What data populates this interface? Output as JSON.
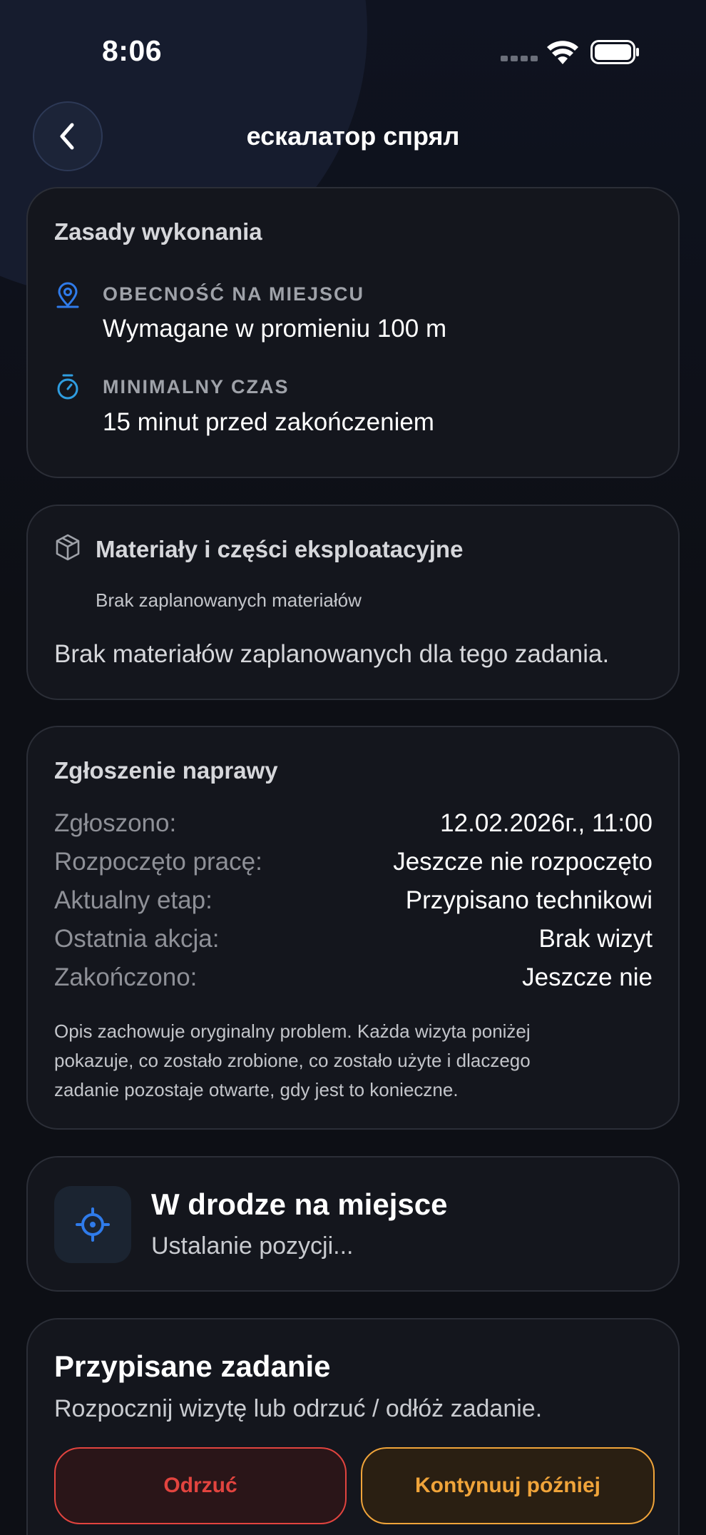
{
  "status_bar": {
    "time": "8:06"
  },
  "nav": {
    "title": "ескалатор спрял"
  },
  "rules_card": {
    "title": "Zasady wykonania",
    "presence_label": "OBECNOŚĆ NA MIEJSCU",
    "presence_value": "Wymagane w promieniu 100 m",
    "min_time_label": "MINIMALNY CZAS",
    "min_time_value": "15 minut przed zakończeniem"
  },
  "materials_card": {
    "title": "Materiały i części eksploatacyjne",
    "subtitle": "Brak zaplanowanych materiałów",
    "body": "Brak materiałów zaplanowanych dla tego zadania."
  },
  "repair_card": {
    "title": "Zgłoszenie naprawy",
    "rows": [
      {
        "label": "Zgłoszono:",
        "value": "12.02.2026г., 11:00"
      },
      {
        "label": "Rozpoczęto pracę:",
        "value": "Jeszcze nie rozpoczęto"
      },
      {
        "label": "Aktualny etap:",
        "value": "Przypisano technikowi"
      },
      {
        "label": "Ostatnia akcja:",
        "value": "Brak wizyt"
      },
      {
        "label": "Zakończono:",
        "value": "Jeszcze nie"
      }
    ],
    "description_lines": [
      "Opis zachowuje oryginalny problem. Każda wizyta poniżej",
      "pokazuje, co zostało zrobione, co zostało użyte i dlaczego",
      "zadanie pozostaje otwarte, gdy jest to konieczne."
    ]
  },
  "location_card": {
    "title": "W drodze na miejsce",
    "subtitle": "Ustalanie pozycji..."
  },
  "assigned_card": {
    "title": "Przypisane zadanie",
    "subtitle": "Rozpocznij wizytę lub odrzuć / odłóż zadanie.",
    "reject_label": "Odrzuć",
    "later_label": "Kontynuuj później"
  },
  "colors": {
    "accent_blue": "#2f7bea",
    "reject_red": "#e2443f",
    "later_orange": "#f0a43a"
  },
  "icons": [
    "back-chevron-icon",
    "map-pin-icon",
    "stopwatch-icon",
    "package-icon",
    "crosshair-icon",
    "wifi-icon",
    "battery-icon",
    "signal-icon"
  ]
}
